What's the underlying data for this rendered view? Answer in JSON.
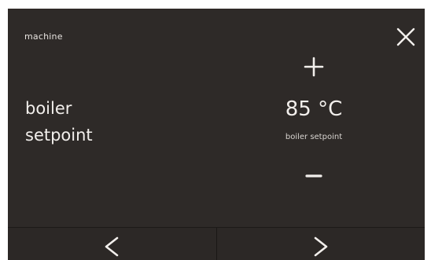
{
  "header": {
    "title": "machine"
  },
  "icons": {
    "close": "close-icon",
    "increase": "plus-icon",
    "decrease": "minus-icon",
    "previous": "chevron-left-icon",
    "next": "chevron-right-icon"
  },
  "parameter": {
    "label_line1": "boiler",
    "label_line2": "setpoint"
  },
  "value": {
    "display": "85 °C",
    "caption": "boiler setpoint"
  },
  "colors": {
    "background": "#2e2a28",
    "text": "#f2efec"
  }
}
